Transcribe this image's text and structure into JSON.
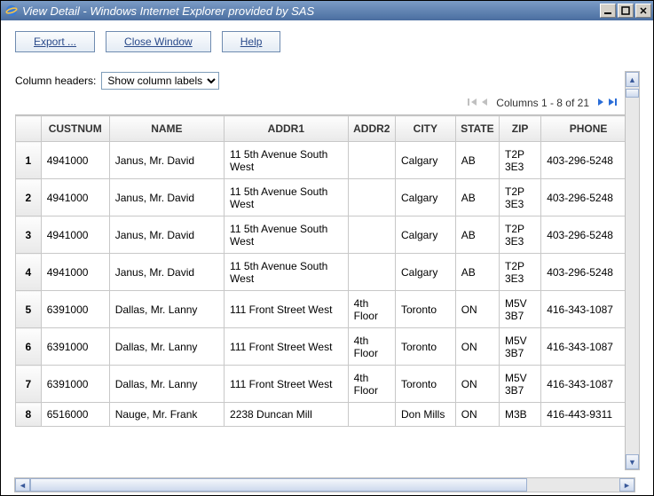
{
  "window": {
    "title": "View Detail - Windows Internet Explorer provided by SAS"
  },
  "buttons": {
    "export": "Export ...",
    "close": "Close Window",
    "help": "Help"
  },
  "controls": {
    "col_header_label": "Column headers:",
    "col_header_value": "Show column labels"
  },
  "pager": {
    "text": "Columns 1 - 8 of 21"
  },
  "table": {
    "headers": [
      "",
      "CUSTNUM",
      "NAME",
      "ADDR1",
      "ADDR2",
      "CITY",
      "STATE",
      "ZIP",
      "PHONE"
    ],
    "rows": [
      {
        "n": "1",
        "custnum": "4941000",
        "name": "Janus, Mr. David",
        "addr1": "11 5th Avenue South West",
        "addr2": "",
        "city": "Calgary",
        "state": "AB",
        "zip": "T2P 3E3",
        "phone": "403-296-5248"
      },
      {
        "n": "2",
        "custnum": "4941000",
        "name": "Janus, Mr. David",
        "addr1": "11 5th Avenue South West",
        "addr2": "",
        "city": "Calgary",
        "state": "AB",
        "zip": "T2P 3E3",
        "phone": "403-296-5248"
      },
      {
        "n": "3",
        "custnum": "4941000",
        "name": "Janus, Mr. David",
        "addr1": "11 5th Avenue South West",
        "addr2": "",
        "city": "Calgary",
        "state": "AB",
        "zip": "T2P 3E3",
        "phone": "403-296-5248"
      },
      {
        "n": "4",
        "custnum": "4941000",
        "name": "Janus, Mr. David",
        "addr1": "11 5th Avenue South West",
        "addr2": "",
        "city": "Calgary",
        "state": "AB",
        "zip": "T2P 3E3",
        "phone": "403-296-5248"
      },
      {
        "n": "5",
        "custnum": "6391000",
        "name": "Dallas, Mr. Lanny",
        "addr1": "111 Front Street West",
        "addr2": "4th Floor",
        "city": "Toronto",
        "state": "ON",
        "zip": "M5V 3B7",
        "phone": "416-343-1087"
      },
      {
        "n": "6",
        "custnum": "6391000",
        "name": "Dallas, Mr. Lanny",
        "addr1": "111 Front Street West",
        "addr2": "4th Floor",
        "city": "Toronto",
        "state": "ON",
        "zip": "M5V 3B7",
        "phone": "416-343-1087"
      },
      {
        "n": "7",
        "custnum": "6391000",
        "name": "Dallas, Mr. Lanny",
        "addr1": "111 Front Street West",
        "addr2": "4th Floor",
        "city": "Toronto",
        "state": "ON",
        "zip": "M5V 3B7",
        "phone": "416-343-1087"
      },
      {
        "n": "8",
        "custnum": "6516000",
        "name": "Nauge, Mr. Frank",
        "addr1": "2238 Duncan Mill",
        "addr2": "",
        "city": "Don Mills",
        "state": "ON",
        "zip": "M3B",
        "phone": "416-443-9311"
      }
    ]
  }
}
